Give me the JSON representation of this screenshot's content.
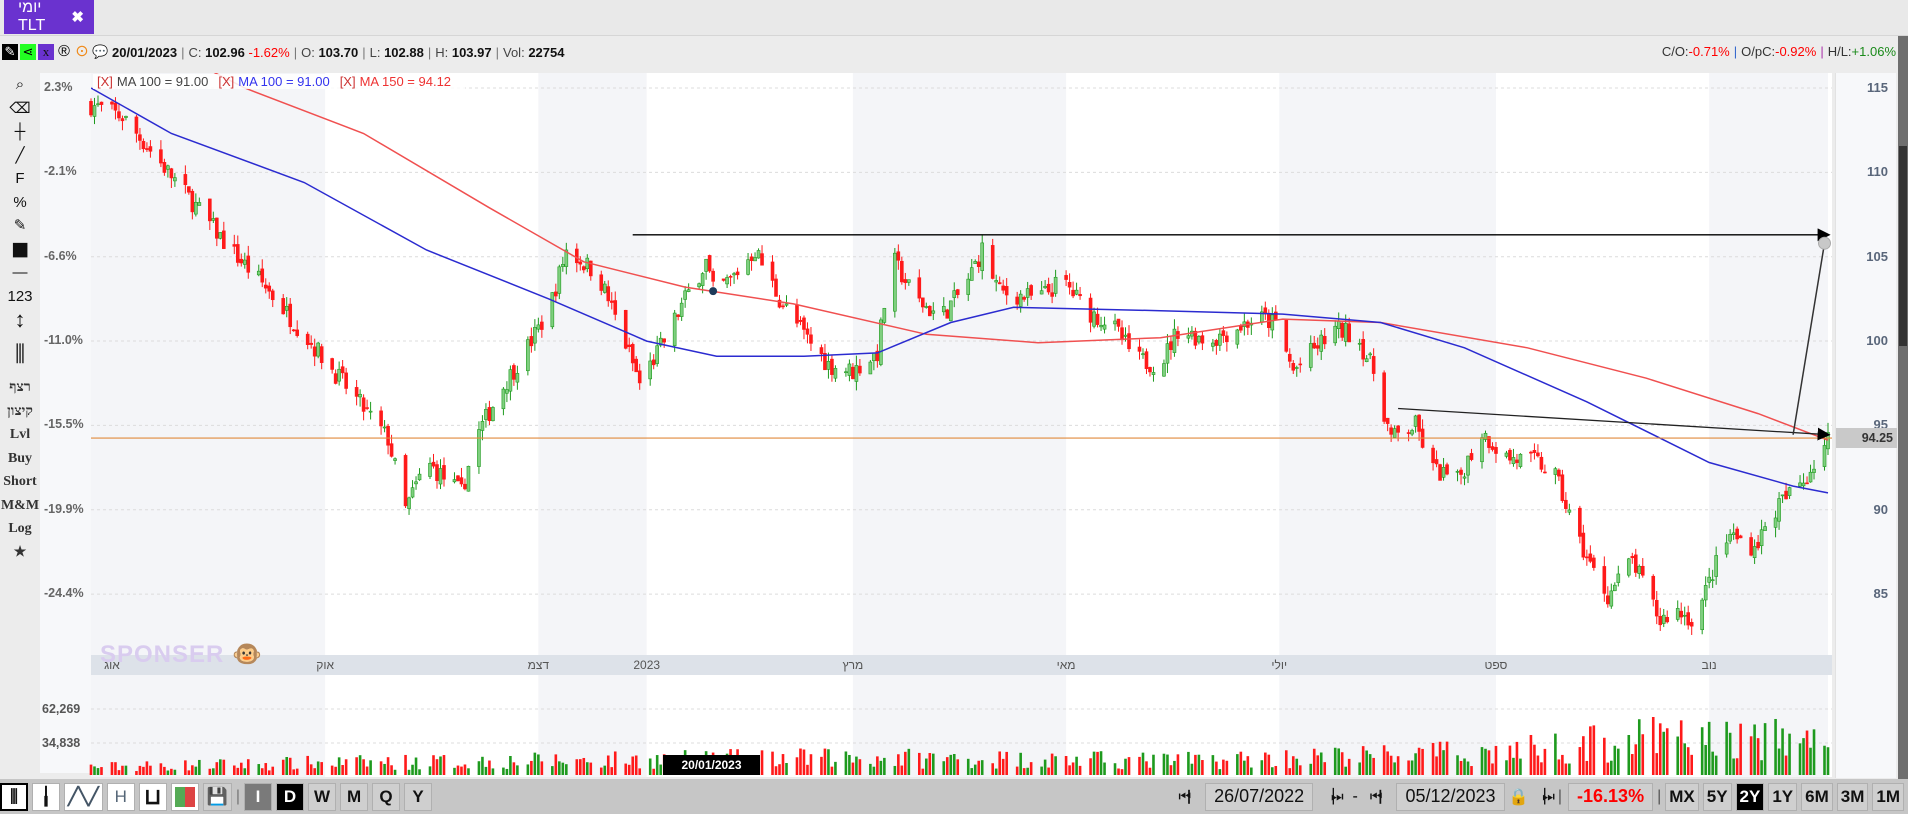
{
  "tab": {
    "label": "יומי TLT",
    "close": "✖"
  },
  "info": {
    "icons": [
      "tools-icon",
      "share-icon",
      "excel-icon",
      "registered-icon",
      "target-icon",
      "chat-icon"
    ],
    "date": "20/01/2023",
    "c_label": "C:",
    "c": "102.96",
    "chg": "-1.62%",
    "o_label": "O:",
    "o": "103.70",
    "l_label": "L:",
    "l": "102.88",
    "h_label": "H:",
    "h": "103.97",
    "vol_label": "Vol:",
    "vol": "22754",
    "co_label": "C/O:",
    "co": "-0.71%",
    "opc_label": "O/pC:",
    "opc": "-0.92%",
    "hl_label": "H/L:",
    "hl": "+1.06%"
  },
  "legend": [
    {
      "x": "[X]",
      "text": "MA 100 = 91.00",
      "color": "#444444"
    },
    {
      "x": "[X]",
      "text": "MA 100 = 91.00",
      "color": "#3333ee"
    },
    {
      "x": "[X]",
      "text": "MA 150 = 94.12",
      "color": "#ee3333"
    }
  ],
  "left_tools": [
    "⌕",
    "⌫",
    "┼",
    "╱",
    "F",
    "%",
    "✎",
    "■",
    "—",
    "123",
    "↕",
    "⫼",
    "רצף",
    "קיצון",
    "Lvl",
    "Buy",
    "Short",
    "M&M",
    "Log",
    "★"
  ],
  "left_tool_names": [
    "zoom-icon",
    "eraser-icon",
    "crosshair-icon",
    "line-icon",
    "fibonacci-icon",
    "percent-icon",
    "edit-icon",
    "color-icon",
    "line-style-icon",
    "numbers-icon",
    "measure-icon",
    "candles-icon",
    "continuous",
    "extreme",
    "level",
    "buy",
    "short",
    "m-and-m",
    "log",
    "star-icon"
  ],
  "pct_axis": [
    "2.3%",
    "-2.1%",
    "-6.6%",
    "-11.0%",
    "-15.5%",
    "-19.9%",
    "-24.4%"
  ],
  "price_axis": [
    "115",
    "110",
    "105",
    "100",
    "95",
    "90",
    "85"
  ],
  "last_price": "94.25",
  "volume_axis": [
    "62,269",
    "34,838"
  ],
  "date_cursor": "20/01/2023",
  "watermark": "SPONSER",
  "colors": {
    "up": "#1e9a1e",
    "down": "#ff1a1a",
    "ma100": "#2b2bd0",
    "ma150": "#f05050",
    "level": "#e08a3c",
    "accent": "#6a32cf"
  },
  "chart_data": {
    "type": "candlestick",
    "x_range": [
      "2022-07-26",
      "2023-12-05"
    ],
    "ylim": [
      82,
      116
    ],
    "month_labels": [
      {
        "d": "2022-08-01",
        "t": "אוג"
      },
      {
        "d": "2022-10-01",
        "t": "אוק"
      },
      {
        "d": "2022-12-01",
        "t": "דצמ"
      },
      {
        "d": "2023-01-01",
        "t": "2023"
      },
      {
        "d": "2023-03-01",
        "t": "מרץ"
      },
      {
        "d": "2023-05-01",
        "t": "מאי"
      },
      {
        "d": "2023-07-01",
        "t": "יולי"
      },
      {
        "d": "2023-09-01",
        "t": "ספט"
      },
      {
        "d": "2023-11-01",
        "t": "נוב"
      }
    ],
    "shaded": [
      [
        "2022-07-26",
        "2022-10-01"
      ],
      [
        "2022-12-01",
        "2023-01-01"
      ],
      [
        "2023-03-01",
        "2023-05-01"
      ],
      [
        "2023-07-01",
        "2023-09-01"
      ],
      [
        "2023-11-01",
        "2023-12-05"
      ]
    ],
    "close_path": [
      [
        "2022-07-26",
        114
      ],
      [
        "2022-08-04",
        113.3
      ],
      [
        "2022-08-14",
        110.8
      ],
      [
        "2022-08-25",
        108
      ],
      [
        "2022-09-04",
        105.4
      ],
      [
        "2022-09-14",
        103.2
      ],
      [
        "2022-09-25",
        100.4
      ],
      [
        "2022-10-02",
        98.6
      ],
      [
        "2022-10-12",
        96
      ],
      [
        "2022-10-19",
        94.2
      ],
      [
        "2022-10-24",
        90
      ],
      [
        "2022-10-30",
        92.8
      ],
      [
        "2022-11-09",
        91
      ],
      [
        "2022-11-13",
        94.2
      ],
      [
        "2022-11-20",
        97
      ],
      [
        "2022-11-27",
        99.3
      ],
      [
        "2022-12-04",
        101.8
      ],
      [
        "2022-12-09",
        105.4
      ],
      [
        "2022-12-18",
        104
      ],
      [
        "2022-12-25",
        100.4
      ],
      [
        "2022-12-30",
        97.5
      ],
      [
        "2023-01-06",
        100
      ],
      [
        "2023-01-12",
        102.5
      ],
      [
        "2023-01-18",
        104.7
      ],
      [
        "2023-01-20",
        102.96
      ],
      [
        "2023-01-25",
        103.6
      ],
      [
        "2023-02-01",
        105.4
      ],
      [
        "2023-02-08",
        102.5
      ],
      [
        "2023-02-15",
        100.4
      ],
      [
        "2023-02-22",
        98.6
      ],
      [
        "2023-03-01",
        98.2
      ],
      [
        "2023-03-08",
        99.3
      ],
      [
        "2023-03-12",
        105
      ],
      [
        "2023-03-19",
        102.5
      ],
      [
        "2023-03-26",
        101.4
      ],
      [
        "2023-04-02",
        103.2
      ],
      [
        "2023-04-07",
        105.4
      ],
      [
        "2023-04-12",
        102.9
      ],
      [
        "2023-04-23",
        102.5
      ],
      [
        "2023-04-30",
        103.6
      ],
      [
        "2023-05-07",
        101.8
      ],
      [
        "2023-05-14",
        101
      ],
      [
        "2023-05-21",
        98.9
      ],
      [
        "2023-05-28",
        98.6
      ],
      [
        "2023-06-02",
        100.7
      ],
      [
        "2023-06-11",
        100
      ],
      [
        "2023-06-18",
        100.7
      ],
      [
        "2023-06-25",
        101.4
      ],
      [
        "2023-06-30",
        101
      ],
      [
        "2023-07-05",
        98.2
      ],
      [
        "2023-07-10",
        99.3
      ],
      [
        "2023-07-17",
        100.7
      ],
      [
        "2023-07-23",
        100.4
      ],
      [
        "2023-07-28",
        98.2
      ],
      [
        "2023-08-02",
        94.2
      ],
      [
        "2023-08-09",
        95
      ],
      [
        "2023-08-14",
        92.4
      ],
      [
        "2023-08-21",
        91.7
      ],
      [
        "2023-08-28",
        94.6
      ],
      [
        "2023-09-04",
        93.1
      ],
      [
        "2023-09-13",
        92.8
      ],
      [
        "2023-09-18",
        92
      ],
      [
        "2023-09-24",
        88.5
      ],
      [
        "2023-09-28",
        86.7
      ],
      [
        "2023-10-03",
        84.9
      ],
      [
        "2023-10-10",
        87
      ],
      [
        "2023-10-18",
        83.4
      ],
      [
        "2023-10-22",
        84.1
      ],
      [
        "2023-10-28",
        83.4
      ],
      [
        "2023-11-02",
        86.3
      ],
      [
        "2023-11-07",
        88.5
      ],
      [
        "2023-11-14",
        87.8
      ],
      [
        "2023-11-21",
        90.3
      ],
      [
        "2023-11-28",
        91.7
      ],
      [
        "2023-12-05",
        94.25
      ]
    ],
    "ma100": [
      [
        "2022-07-26",
        115
      ],
      [
        "2022-08-18",
        112.3
      ],
      [
        "2022-09-25",
        109.4
      ],
      [
        "2022-10-30",
        105.4
      ],
      [
        "2022-12-04",
        102.5
      ],
      [
        "2023-01-01",
        100
      ],
      [
        "2023-01-21",
        99.1
      ],
      [
        "2023-02-15",
        99.1
      ],
      [
        "2023-03-08",
        99.3
      ],
      [
        "2023-03-29",
        101.1
      ],
      [
        "2023-04-16",
        102
      ],
      [
        "2023-05-28",
        101.8
      ],
      [
        "2023-07-02",
        101.6
      ],
      [
        "2023-07-30",
        101.1
      ],
      [
        "2023-08-23",
        99.6
      ],
      [
        "2023-09-27",
        96.4
      ],
      [
        "2023-11-01",
        92.8
      ],
      [
        "2023-11-25",
        91.4
      ],
      [
        "2023-12-05",
        91
      ]
    ],
    "ma150": [
      [
        "2022-08-20",
        117
      ],
      [
        "2022-09-08",
        115
      ],
      [
        "2022-10-12",
        112.3
      ],
      [
        "2022-11-17",
        107.9
      ],
      [
        "2022-12-14",
        104.7
      ],
      [
        "2023-01-12",
        103.2
      ],
      [
        "2023-02-12",
        102.2
      ],
      [
        "2023-03-22",
        100.4
      ],
      [
        "2023-04-23",
        99.9
      ],
      [
        "2023-05-28",
        100.2
      ],
      [
        "2023-07-02",
        101.3
      ],
      [
        "2023-07-30",
        101.1
      ],
      [
        "2023-09-10",
        99.6
      ],
      [
        "2023-10-14",
        97.8
      ],
      [
        "2023-11-15",
        95.7
      ],
      [
        "2023-12-05",
        94.12
      ]
    ],
    "volume_level": [
      [
        "2022-07-26",
        8000
      ],
      [
        "2022-10-01",
        12000
      ],
      [
        "2022-12-01",
        14000
      ],
      [
        "2023-03-01",
        17000
      ],
      [
        "2023-06-01",
        14000
      ],
      [
        "2023-09-01",
        22000
      ],
      [
        "2023-10-15",
        36000
      ],
      [
        "2023-12-05",
        34000
      ]
    ],
    "drawings": {
      "resistance": [
        [
          "2022-12-28",
          106.3
        ],
        [
          "2023-12-05",
          106.3
        ]
      ],
      "trendline": [
        [
          "2023-08-04",
          96
        ],
        [
          "2023-12-05",
          94.45
        ]
      ],
      "level": 94.25,
      "projection": [
        [
          "2023-11-25",
          94.45
        ],
        [
          "2023-12-04",
          105.8
        ]
      ],
      "cursor_point": [
        "2023-01-20",
        102.96
      ]
    }
  },
  "bottom": {
    "chart_types": [
      "candles-icon",
      "bars-icon",
      "line-icon",
      "heikin-ashi",
      "u-icon",
      "color-bars-icon",
      "save-icon"
    ],
    "h_label": "H",
    "intervals": [
      "I",
      "D",
      "W",
      "M",
      "Q",
      "Y"
    ],
    "selected_interval": "D",
    "from_date": "26/07/2022",
    "to_date": "05/12/2023",
    "dash": "-",
    "range_change": "-16.13%",
    "ranges": [
      "MX",
      "5Y",
      "2Y",
      "1Y",
      "6M",
      "3M",
      "1M"
    ],
    "selected_range": "2Y"
  }
}
